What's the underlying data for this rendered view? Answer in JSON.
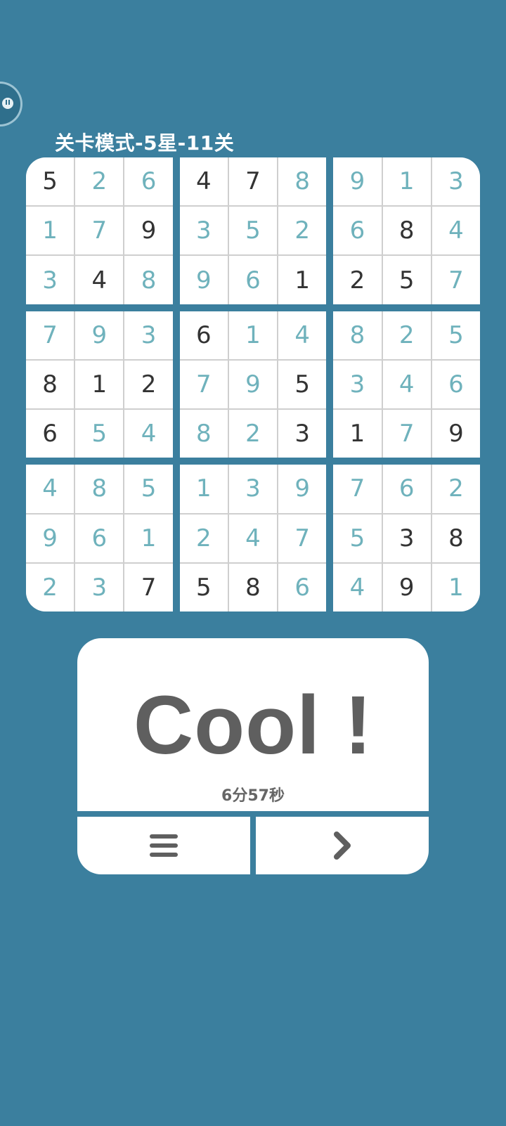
{
  "header": {
    "title": "关卡模式-5星-11关"
  },
  "board": {
    "rows": [
      [
        {
          "v": "5",
          "s": "given"
        },
        {
          "v": "2",
          "s": "filled"
        },
        {
          "v": "6",
          "s": "filled"
        },
        {
          "v": "4",
          "s": "given"
        },
        {
          "v": "7",
          "s": "given"
        },
        {
          "v": "8",
          "s": "filled"
        },
        {
          "v": "9",
          "s": "filled"
        },
        {
          "v": "1",
          "s": "filled"
        },
        {
          "v": "3",
          "s": "filled"
        }
      ],
      [
        {
          "v": "1",
          "s": "filled"
        },
        {
          "v": "7",
          "s": "filled"
        },
        {
          "v": "9",
          "s": "given"
        },
        {
          "v": "3",
          "s": "filled"
        },
        {
          "v": "5",
          "s": "filled"
        },
        {
          "v": "2",
          "s": "filled"
        },
        {
          "v": "6",
          "s": "filled"
        },
        {
          "v": "8",
          "s": "given"
        },
        {
          "v": "4",
          "s": "filled"
        }
      ],
      [
        {
          "v": "3",
          "s": "filled"
        },
        {
          "v": "4",
          "s": "given"
        },
        {
          "v": "8",
          "s": "filled"
        },
        {
          "v": "9",
          "s": "filled"
        },
        {
          "v": "6",
          "s": "filled"
        },
        {
          "v": "1",
          "s": "given"
        },
        {
          "v": "2",
          "s": "given"
        },
        {
          "v": "5",
          "s": "given"
        },
        {
          "v": "7",
          "s": "filled"
        }
      ],
      [
        {
          "v": "7",
          "s": "filled"
        },
        {
          "v": "9",
          "s": "filled"
        },
        {
          "v": "3",
          "s": "filled"
        },
        {
          "v": "6",
          "s": "given"
        },
        {
          "v": "1",
          "s": "filled"
        },
        {
          "v": "4",
          "s": "filled"
        },
        {
          "v": "8",
          "s": "filled"
        },
        {
          "v": "2",
          "s": "filled"
        },
        {
          "v": "5",
          "s": "filled"
        }
      ],
      [
        {
          "v": "8",
          "s": "given"
        },
        {
          "v": "1",
          "s": "given"
        },
        {
          "v": "2",
          "s": "given"
        },
        {
          "v": "7",
          "s": "filled"
        },
        {
          "v": "9",
          "s": "filled"
        },
        {
          "v": "5",
          "s": "given"
        },
        {
          "v": "3",
          "s": "filled"
        },
        {
          "v": "4",
          "s": "filled"
        },
        {
          "v": "6",
          "s": "filled"
        }
      ],
      [
        {
          "v": "6",
          "s": "given"
        },
        {
          "v": "5",
          "s": "filled"
        },
        {
          "v": "4",
          "s": "filled"
        },
        {
          "v": "8",
          "s": "filled"
        },
        {
          "v": "2",
          "s": "filled"
        },
        {
          "v": "3",
          "s": "given"
        },
        {
          "v": "1",
          "s": "given"
        },
        {
          "v": "7",
          "s": "filled"
        },
        {
          "v": "9",
          "s": "given"
        }
      ],
      [
        {
          "v": "4",
          "s": "filled"
        },
        {
          "v": "8",
          "s": "filled"
        },
        {
          "v": "5",
          "s": "filled"
        },
        {
          "v": "1",
          "s": "filled"
        },
        {
          "v": "3",
          "s": "filled"
        },
        {
          "v": "9",
          "s": "filled"
        },
        {
          "v": "7",
          "s": "filled"
        },
        {
          "v": "6",
          "s": "filled"
        },
        {
          "v": "2",
          "s": "filled"
        }
      ],
      [
        {
          "v": "9",
          "s": "filled"
        },
        {
          "v": "6",
          "s": "filled"
        },
        {
          "v": "1",
          "s": "filled"
        },
        {
          "v": "2",
          "s": "filled"
        },
        {
          "v": "4",
          "s": "filled"
        },
        {
          "v": "7",
          "s": "filled"
        },
        {
          "v": "5",
          "s": "filled"
        },
        {
          "v": "3",
          "s": "given"
        },
        {
          "v": "8",
          "s": "given"
        }
      ],
      [
        {
          "v": "2",
          "s": "filled"
        },
        {
          "v": "3",
          "s": "filled"
        },
        {
          "v": "7",
          "s": "given"
        },
        {
          "v": "5",
          "s": "given"
        },
        {
          "v": "8",
          "s": "given"
        },
        {
          "v": "6",
          "s": "filled"
        },
        {
          "v": "4",
          "s": "filled"
        },
        {
          "v": "9",
          "s": "given"
        },
        {
          "v": "1",
          "s": "filled"
        }
      ]
    ]
  },
  "result": {
    "message": "Cool !",
    "time": "6分57秒"
  },
  "buttons": {
    "menu_icon": "menu-icon",
    "next_icon": "chevron-right-icon"
  },
  "colors": {
    "background": "#3b7f9e",
    "given_digit": "#333333",
    "filled_digit": "#6fb2bc",
    "card": "#ffffff",
    "cool_text": "#5f5f5f"
  }
}
